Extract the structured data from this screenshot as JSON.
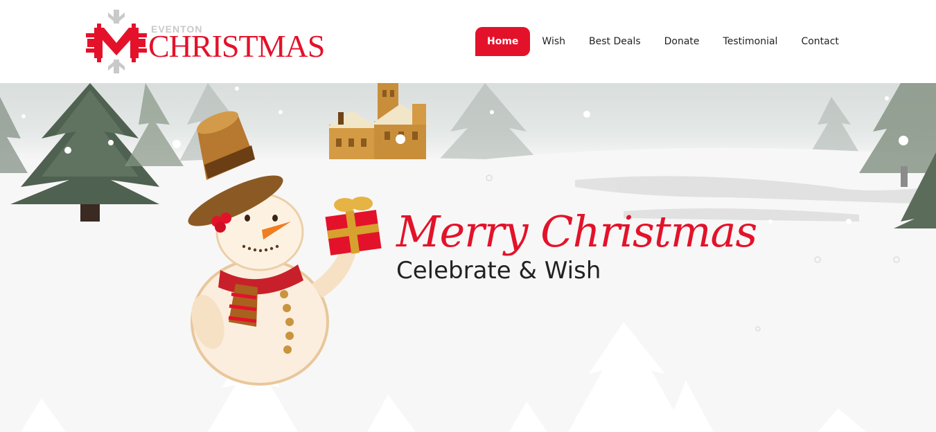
{
  "brand": {
    "top_text": "EVENTON",
    "main_text": "CHRISTMAS",
    "colors": {
      "red": "#e3122a",
      "grey": "#c9c9c9"
    },
    "icon": "snowflake-logo-icon"
  },
  "nav": {
    "items": [
      {
        "label": "Home",
        "active": true
      },
      {
        "label": "Wish",
        "active": false
      },
      {
        "label": "Best Deals",
        "active": false
      },
      {
        "label": "Donate",
        "active": false
      },
      {
        "label": "Testimonial",
        "active": false
      },
      {
        "label": "Contact",
        "active": false
      }
    ]
  },
  "hero": {
    "script_title": "Merry Christmas",
    "subtitle": "Celebrate & Wish",
    "illustration": "snowman-with-gift"
  }
}
